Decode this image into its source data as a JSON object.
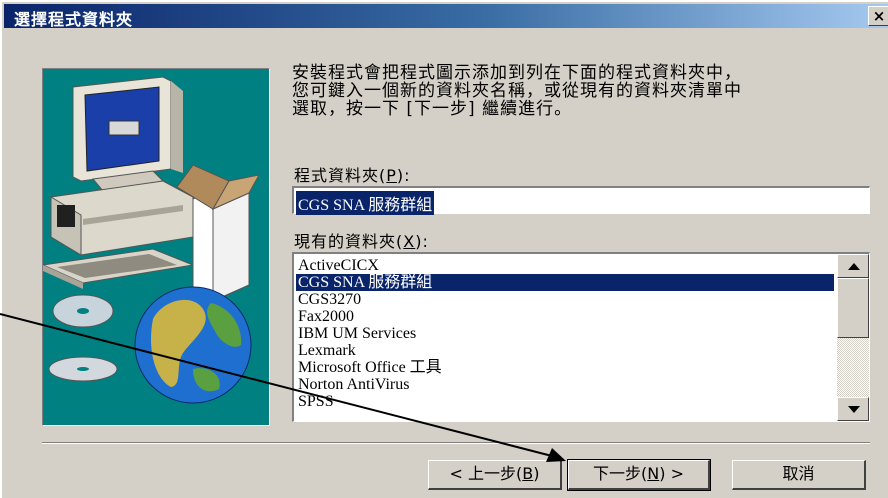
{
  "window": {
    "title": "選擇程式資料夾",
    "close_label": "×"
  },
  "description": {
    "lines": [
      "安裝程式會把程式圖示添加到列在下面的程式資料夾中，",
      "您可鍵入一個新的資料夾名稱，或從現有的資料夾清單中",
      "選取，按一下 [下一步] 繼續進行。"
    ]
  },
  "program_folder": {
    "label": "程式資料夾",
    "accel": "P",
    "label_close": "):",
    "value": "CGS SNA 服務群組"
  },
  "existing_folders": {
    "label": "現有的資料夾",
    "accel": "X",
    "label_close": "):",
    "items": [
      "ActiveCICX",
      "CGS SNA 服務群組",
      "CGS3270",
      "Fax2000",
      "IBM UM Services",
      "Lexmark",
      "Microsoft Office 工具",
      "Norton AntiVirus",
      "SPSS"
    ],
    "selected_index": 1
  },
  "buttons": {
    "back": {
      "prefix": "< 上一步(",
      "accel": "B",
      "suffix": ")"
    },
    "next": {
      "prefix": "下一步(",
      "accel": "N",
      "suffix": ") >"
    },
    "cancel": "取消"
  },
  "colors": {
    "title_bar_start": "#0a246a",
    "title_bar_end": "#a6caf0",
    "dialog_face": "#d4d0c8",
    "selection": "#0a246a",
    "art_background": "#008080"
  },
  "icons": [
    "close-icon",
    "computer-icon",
    "software-box-icon",
    "cd-disc-icon",
    "globe-icon",
    "scroll-up-icon",
    "scroll-down-icon",
    "annotation-arrow"
  ]
}
